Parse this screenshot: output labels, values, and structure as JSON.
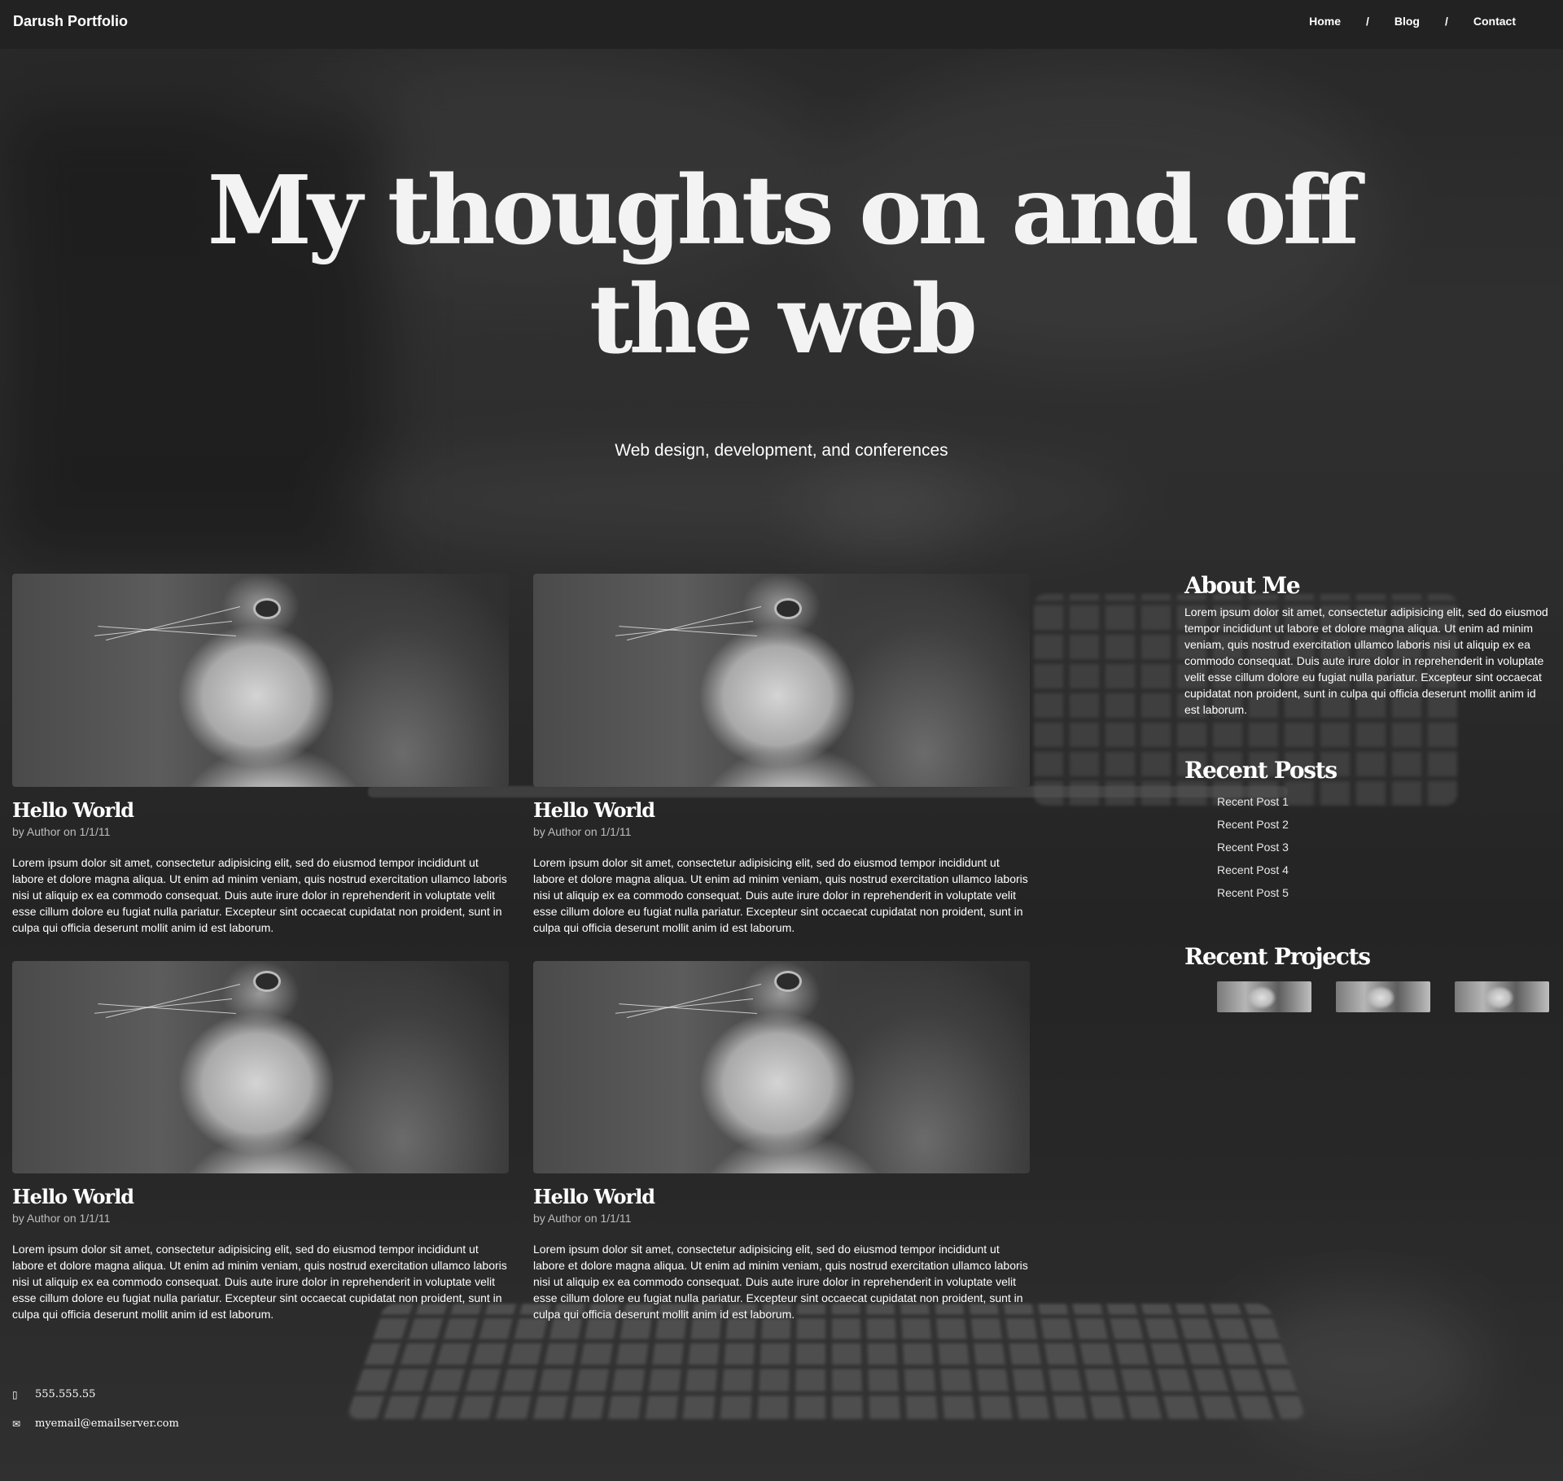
{
  "nav": {
    "brand": "Darush Portfolio",
    "links": [
      "Home",
      "Blog",
      "Contact"
    ],
    "separator": "/"
  },
  "hero": {
    "title": "My thoughts on and off the web",
    "subtitle": "Web design, development, and conferences"
  },
  "posts": [
    {
      "title": "Hello World",
      "meta": "by Author on 1/1/11",
      "body": "Lorem ipsum dolor sit amet, consectetur adipisicing elit, sed do eiusmod tempor incididunt ut labore et dolore magna aliqua. Ut enim ad minim veniam, quis nostrud exercitation ullamco laboris nisi ut aliquip ex ea commodo consequat. Duis aute irure dolor in reprehenderit in voluptate velit esse cillum dolore eu fugiat nulla pariatur. Excepteur sint occaecat cupidatat non proident, sunt in culpa qui officia deserunt mollit anim id est laborum."
    },
    {
      "title": "Hello World",
      "meta": "by Author on 1/1/11",
      "body": "Lorem ipsum dolor sit amet, consectetur adipisicing elit, sed do eiusmod tempor incididunt ut labore et dolore magna aliqua. Ut enim ad minim veniam, quis nostrud exercitation ullamco laboris nisi ut aliquip ex ea commodo consequat. Duis aute irure dolor in reprehenderit in voluptate velit esse cillum dolore eu fugiat nulla pariatur. Excepteur sint occaecat cupidatat non proident, sunt in culpa qui officia deserunt mollit anim id est laborum."
    },
    {
      "title": "Hello World",
      "meta": "by Author on 1/1/11",
      "body": "Lorem ipsum dolor sit amet, consectetur adipisicing elit, sed do eiusmod tempor incididunt ut labore et dolore magna aliqua. Ut enim ad minim veniam, quis nostrud exercitation ullamco laboris nisi ut aliquip ex ea commodo consequat. Duis aute irure dolor in reprehenderit in voluptate velit esse cillum dolore eu fugiat nulla pariatur. Excepteur sint occaecat cupidatat non proident, sunt in culpa qui officia deserunt mollit anim id est laborum."
    },
    {
      "title": "Hello World",
      "meta": "by Author on 1/1/11",
      "body": "Lorem ipsum dolor sit amet, consectetur adipisicing elit, sed do eiusmod tempor incididunt ut labore et dolore magna aliqua. Ut enim ad minim veniam, quis nostrud exercitation ullamco laboris nisi ut aliquip ex ea commodo consequat. Duis aute irure dolor in reprehenderit in voluptate velit esse cillum dolore eu fugiat nulla pariatur. Excepteur sint occaecat cupidatat non proident, sunt in culpa qui officia deserunt mollit anim id est laborum."
    }
  ],
  "sidebar": {
    "about_title": "About Me",
    "about_text": "Lorem ipsum dolor sit amet, consectetur adipisicing elit, sed do eiusmod tempor incididunt ut labore et dolore magna aliqua. Ut enim ad minim veniam, quis nostrud exercitation ullamco laboris nisi ut aliquip ex ea commodo consequat. Duis aute irure dolor in reprehenderit in voluptate velit esse cillum dolore eu fugiat nulla pariatur. Excepteur sint occaecat cupidatat non proident, sunt in culpa qui officia deserunt mollit anim id est laborum.",
    "recent_posts_title": "Recent Posts",
    "recent_posts": [
      "Recent Post 1",
      "Recent Post 2",
      "Recent Post 3",
      "Recent Post 4",
      "Recent Post 5"
    ],
    "recent_projects_title": "Recent Projects"
  },
  "footer": {
    "phone": "555.555.55",
    "email": "myemail@emailserver.com",
    "phone_icon": "mobile-phone-icon",
    "email_icon": "envelope-icon"
  },
  "colors": {
    "navbar_bg": "#222222",
    "text": "#ffffff",
    "meta_text": "#bdbdbd"
  }
}
